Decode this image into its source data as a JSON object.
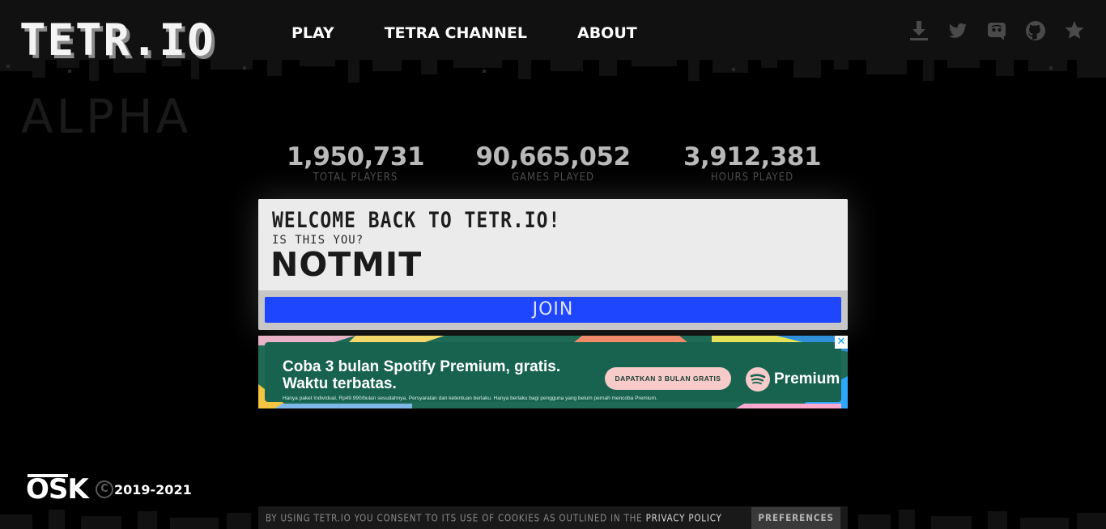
{
  "header": {
    "logo_text": "TETR.IO",
    "alpha_text": "ALPHA",
    "nav": [
      {
        "label": "PLAY"
      },
      {
        "label": "TETRA CHANNEL"
      },
      {
        "label": "ABOUT"
      }
    ],
    "social_icons": [
      "download-icon",
      "twitter-icon",
      "discord-icon",
      "github-icon",
      "star-icon"
    ]
  },
  "stats": [
    {
      "value": "1,950,731",
      "label": "TOTAL PLAYERS"
    },
    {
      "value": "90,665,052",
      "label": "GAMES PLAYED"
    },
    {
      "value": "3,912,381",
      "label": "HOURS PLAYED"
    }
  ],
  "welcome": {
    "title": "WELCOME BACK TO TETR.IO!",
    "subtitle": "IS THIS YOU?",
    "username": "NOTMIT",
    "join_label": "JOIN"
  },
  "ad": {
    "headline_line1": "Coba 3 bulan Spotify Premium, gratis.",
    "headline_line2": "Waktu terbatas.",
    "fineprint": "Hanya paket Individual. Rp49.990/bulan sesudahnya. Persyaratan dan ketentuan berlaku. Hanya berlaku bagi pengguna yang belum pernah mencoba Premium.",
    "cta": "DAPATKAN 3 BULAN GRATIS",
    "brand": "Premium",
    "close_glyph": "✕"
  },
  "footer": {
    "osk_text": "OSK",
    "copyright_glyph": "C",
    "copyright_years": "2019-2021",
    "cookie_text": "BY USING TETR.IO YOU CONSENT TO ITS USE OF COOKIES AS OUTLINED IN THE ",
    "privacy_link": "PRIVACY POLICY",
    "preferences_label": "PREFERENCES"
  },
  "colors": {
    "background": "#000000",
    "header": "#111111",
    "join_button": "#1e46ff",
    "card": "#ebebeb",
    "ad_green": "#1f6a55",
    "ad_cta": "#f6cbc9"
  }
}
